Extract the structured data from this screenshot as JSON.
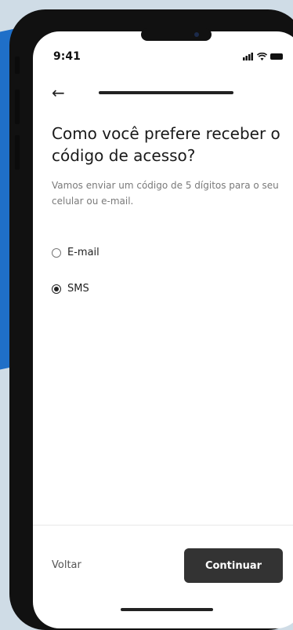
{
  "status_bar": {
    "time": "9:41"
  },
  "header": {
    "progress": 1.0
  },
  "content": {
    "title": "Como você prefere receber o código de acesso?",
    "subtitle": "Vamos enviar um código de 5 dígitos para o seu celular ou e-mail."
  },
  "options": [
    {
      "label": "E-mail",
      "selected": false
    },
    {
      "label": "SMS",
      "selected": true
    }
  ],
  "footer": {
    "back_label": "Voltar",
    "continue_label": "Continuar"
  },
  "colors": {
    "accent_background": "#1f6fc8",
    "primary_button": "#333333"
  }
}
